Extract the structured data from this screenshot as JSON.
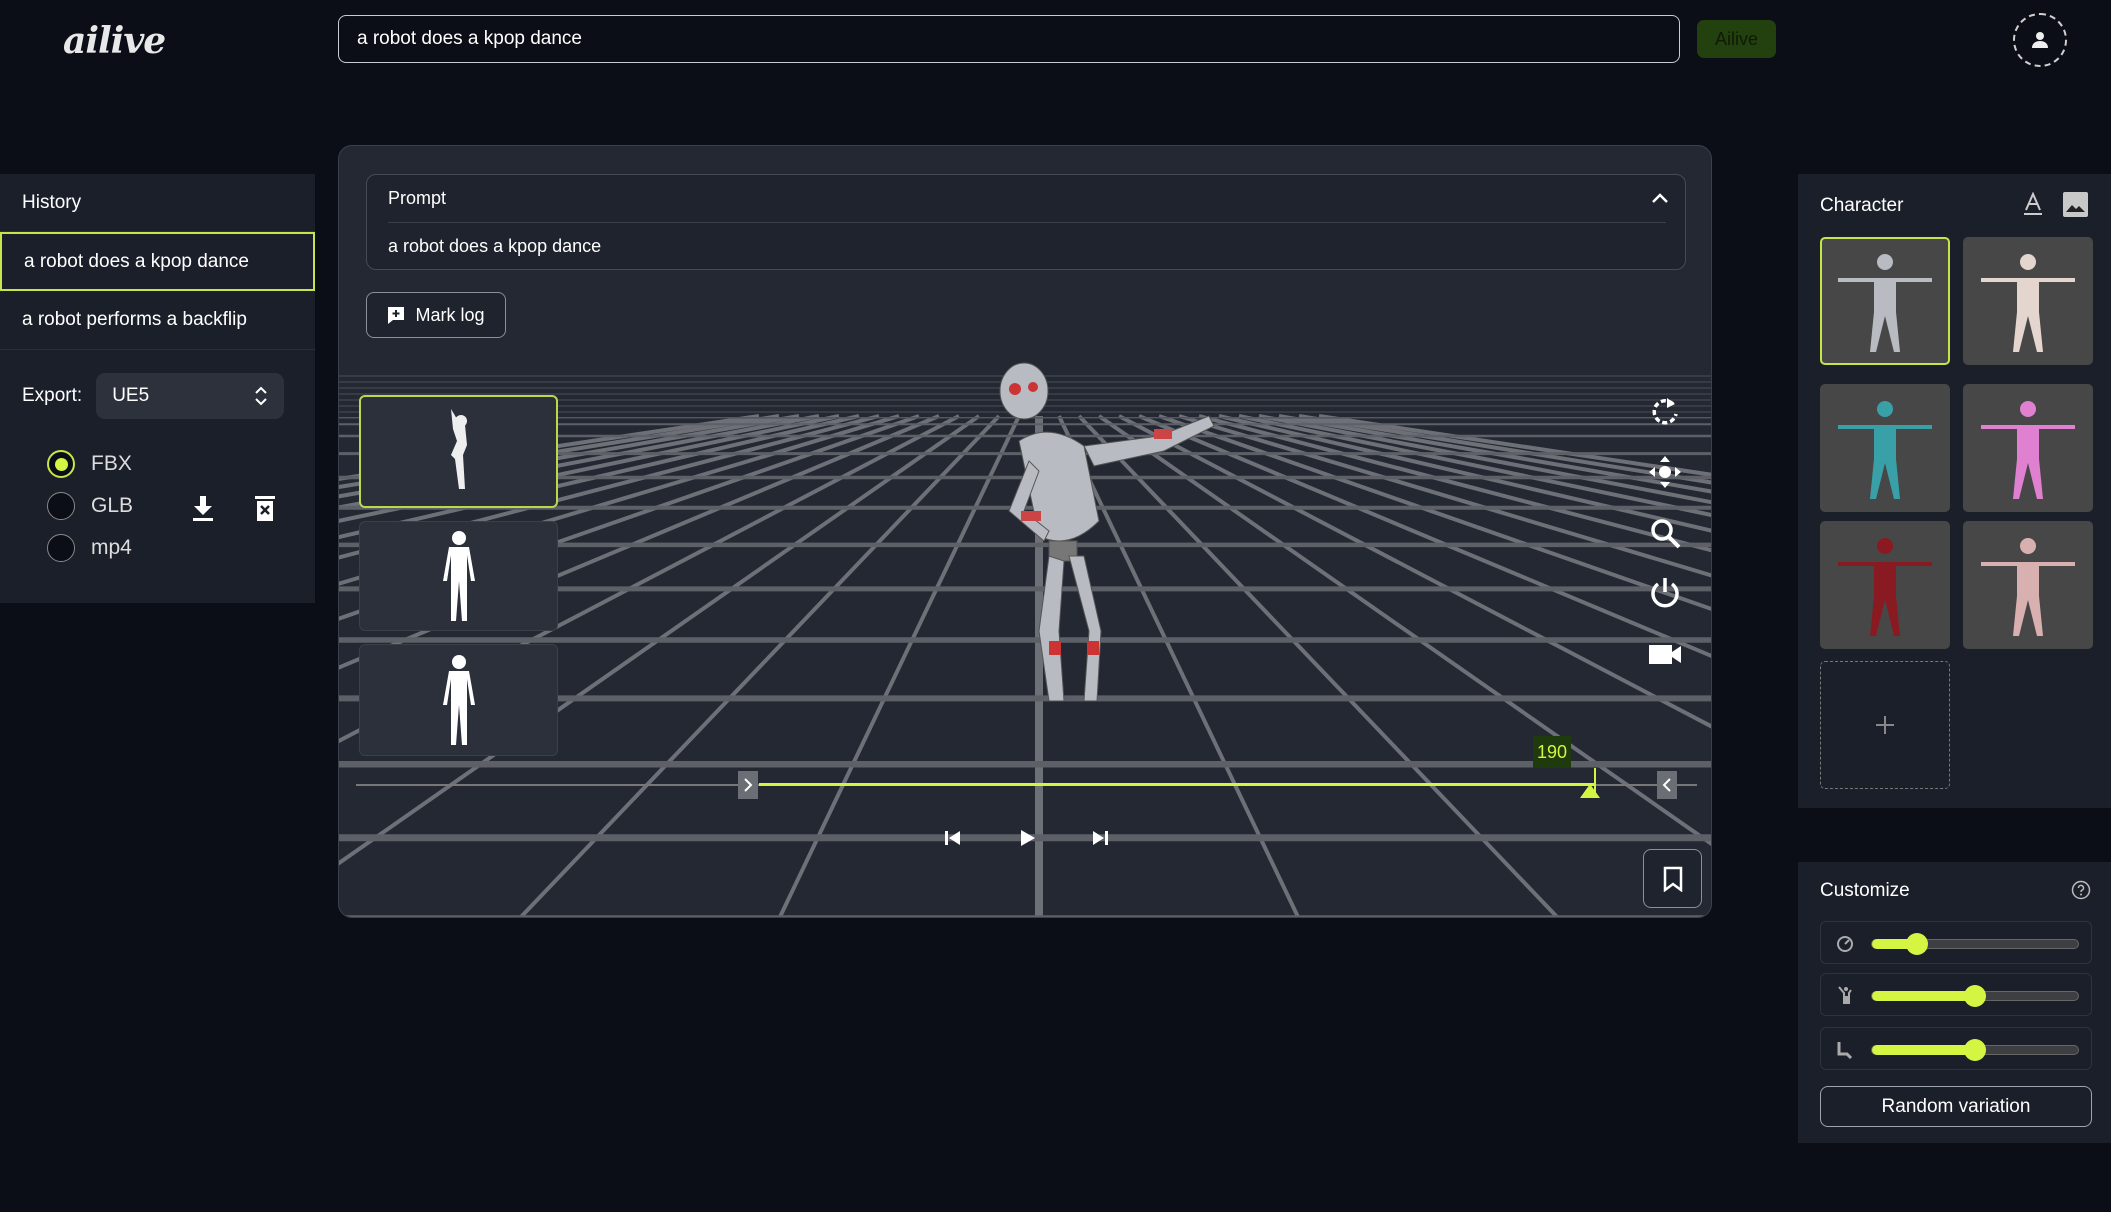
{
  "header": {
    "logo": "ailive",
    "search_value": "a robot does a kpop dance",
    "search_placeholder": "",
    "submit_label": "Ailive"
  },
  "history": {
    "title": "History",
    "items": [
      {
        "label": "a robot does a kpop dance",
        "selected": true
      },
      {
        "label": "a robot performs a backflip",
        "selected": false
      }
    ]
  },
  "export": {
    "label": "Export:",
    "selected": "UE5",
    "formats": [
      {
        "label": "FBX",
        "checked": true
      },
      {
        "label": "GLB",
        "checked": false
      },
      {
        "label": "mp4",
        "checked": false
      }
    ]
  },
  "viewer": {
    "prompt_title": "Prompt",
    "prompt_text": "a robot does a kpop dance",
    "mark_log_label": "Mark log",
    "frame_label": "190",
    "timeline_progress": 0.93
  },
  "character": {
    "title": "Character",
    "count": 6
  },
  "customize": {
    "title": "Customize",
    "sliders": [
      {
        "icon": "speedometer-icon",
        "value": 0.22
      },
      {
        "icon": "dance-pose-icon",
        "value": 0.5
      },
      {
        "icon": "seated-pose-icon",
        "value": 0.5
      }
    ],
    "random_label": "Random variation"
  },
  "colors": {
    "accent": "#d4f542",
    "background": "#0b0e17",
    "panel": "#1a1f2a"
  }
}
